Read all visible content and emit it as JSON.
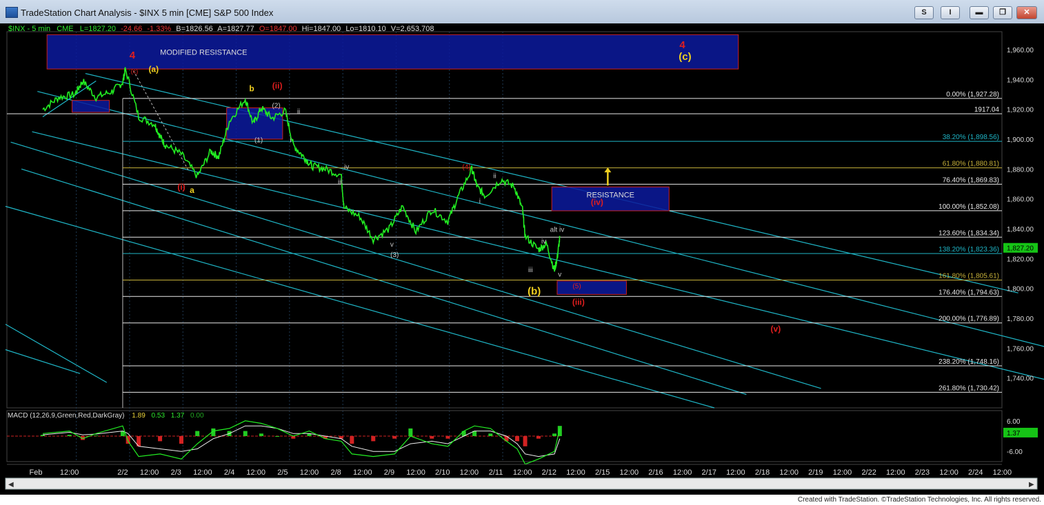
{
  "window": {
    "title": "TradeStation Chart Analysis - $INX 5 min [CME] S&P 500 Index",
    "btn_s": "S",
    "btn_i": "I",
    "min_glyph": "▬",
    "max_glyph": "❐",
    "close_glyph": "✕"
  },
  "colors": {
    "price": "#22ee22",
    "trendline": "#1fb7c8",
    "fib": "#e8e8e8",
    "fib_gold": "#c8b23a",
    "box_fill": "#0c1a9e",
    "box_border": "#c81e1e",
    "label_red": "#e01e1e",
    "label_yellow": "#f0d020",
    "macd": "#22ee22",
    "signal": "#e01e1e"
  },
  "footer": "Created with TradeStation. ©TradeStation Technologies, Inc. All rights reserved.",
  "chart_data": {
    "type": "line",
    "symbol_bar": {
      "name": "$INX - 5 min",
      "exchange": "CME",
      "last": "L=1827.20",
      "change": "-24.66",
      "change_pct": "-1.33%",
      "bid": "B=1826.56",
      "ask": "A=1827.77",
      "open": "O=1847.00",
      "high": "Hi=1847.00",
      "low": "Lo=1810.10",
      "volume": "V=2,653,708"
    },
    "ylim": [
      1720,
      1972
    ],
    "y_ticks": [
      "1,960.00",
      "1,940.00",
      "1,920.00",
      "1,900.00",
      "1,880.00",
      "1,860.00",
      "1,840.00",
      "1,820.00",
      "1,800.00",
      "1,780.00",
      "1,760.00",
      "1,740.00"
    ],
    "last_price_tag": "1,827.20",
    "x_ticks": [
      "Feb",
      "12:00",
      "2/2",
      "12:00",
      "2/3",
      "12:00",
      "2/4",
      "12:00",
      "2/5",
      "12:00",
      "2/8",
      "12:00",
      "2/9",
      "12:00",
      "2/10",
      "12:00",
      "2/11",
      "12:00",
      "2/12",
      "12:00",
      "2/15",
      "12:00",
      "2/16",
      "12:00",
      "2/17",
      "12:00",
      "2/18",
      "12:00",
      "2/19",
      "12:00",
      "2/22",
      "12:00",
      "2/23",
      "12:00",
      "2/24",
      "12:00"
    ],
    "x_tick_pos": [
      0.5,
      1,
      2,
      2.5,
      3,
      3.5,
      4,
      4.5,
      5,
      5.5,
      6,
      6.5,
      7,
      7.5,
      8,
      8.5,
      9,
      9.5,
      10,
      10.5,
      11,
      11.5,
      12,
      12.5,
      13,
      13.5,
      14,
      14.5,
      15,
      15.5,
      16,
      16.5,
      17,
      17.5,
      18,
      18.5
    ],
    "series": [
      {
        "x": [
          0,
          0.3,
          0.6,
          0.75,
          1,
          1.3,
          1.5,
          1.55,
          1.8,
          2.1,
          2.2,
          2.3,
          2.6,
          2.9,
          3.15,
          3.3,
          3.5,
          3.8,
          3.95,
          4.1,
          4.3,
          4.55,
          4.7,
          4.9,
          5.05,
          5.3,
          5.6,
          5.65,
          5.95,
          6.2,
          6.5,
          6.75,
          7.0,
          7.3,
          7.6,
          7.8,
          8.05,
          8.15,
          8.3,
          8.6,
          8.85,
          9.0,
          9.05,
          9.3,
          9.45,
          9.6,
          9.65,
          9.7
        ],
        "values": [
          1920,
          1928,
          1930,
          1939,
          1928,
          1932,
          1938,
          1947,
          1915,
          1910,
          1902,
          1896,
          1890,
          1875,
          1892,
          1888,
          1912,
          1927,
          1910,
          1921,
          1914,
          1919,
          1896,
          1888,
          1882,
          1880,
          1876,
          1854,
          1848,
          1833,
          1840,
          1855,
          1838,
          1853,
          1845,
          1862,
          1880,
          1868,
          1862,
          1873,
          1868,
          1853,
          1835,
          1826,
          1830,
          1812,
          1820,
          1834
        ]
      }
    ],
    "fib_levels": [
      {
        "label": "0.00% (1,927.28)",
        "value": 1927.28
      },
      {
        "label": "1917.04",
        "value": 1917.04
      },
      {
        "label": "38.20% (1,898.56)",
        "value": 1898.56
      },
      {
        "label": "61.80% (1,880.81)",
        "value": 1880.81
      },
      {
        "label": "76.40% (1,869.83)",
        "value": 1869.83
      },
      {
        "label": "100.00% (1,852.08)",
        "value": 1852.08
      },
      {
        "label": "123.60% (1,834.34)",
        "value": 1834.34
      },
      {
        "label": "138.20% (1,823.36)",
        "value": 1823.36
      },
      {
        "label": "161.80% (1,805.61)",
        "value": 1805.61
      },
      {
        "label": "176.40% (1,794.63)",
        "value": 1794.63
      },
      {
        "label": "200.00% (1,776.89)",
        "value": 1776.89
      },
      {
        "label": "238.20% (1,748.16)",
        "value": 1748.16
      },
      {
        "label": "261.80% (1,730.42)",
        "value": 1730.42
      }
    ],
    "boxes": [
      {
        "label": "MODIFIED RESISTANCE",
        "x0": 0.08,
        "x1": 13.05,
        "y0": 1947,
        "y1": 1970
      },
      {
        "label": "RESISTANCE",
        "x0": 9.55,
        "x1": 11.75,
        "y0": 1852,
        "y1": 1868
      },
      {
        "label": "",
        "x0": 0.55,
        "x1": 1.25,
        "y0": 1918,
        "y1": 1926
      },
      {
        "label": "",
        "x0": 3.45,
        "x1": 4.5,
        "y0": 1900,
        "y1": 1921
      },
      {
        "label": "",
        "x0": 9.65,
        "x1": 10.95,
        "y0": 1796,
        "y1": 1805
      }
    ],
    "annotations": [
      {
        "text": "4",
        "x": 1.68,
        "y": 1954,
        "color": "red",
        "size": 15
      },
      {
        "text": "(c)",
        "x": 1.72,
        "y": 1944,
        "color": "red",
        "size": 9
      },
      {
        "text": "(a)",
        "x": 2.08,
        "y": 1945,
        "color": "yellow",
        "size": 12
      },
      {
        "text": "b",
        "x": 3.92,
        "y": 1932,
        "color": "yellow",
        "size": 12
      },
      {
        "text": "(ii)",
        "x": 4.4,
        "y": 1934,
        "color": "red",
        "size": 12
      },
      {
        "text": "(2)",
        "x": 4.38,
        "y": 1921,
        "color": "gray",
        "size": 10
      },
      {
        "text": "ii",
        "x": 4.8,
        "y": 1917,
        "color": "gray",
        "size": 10
      },
      {
        "text": "(1)",
        "x": 4.05,
        "y": 1898,
        "color": "gray",
        "size": 10
      },
      {
        "text": "i",
        "x": 4.65,
        "y": 1898,
        "color": "gray",
        "size": 10
      },
      {
        "text": "iv",
        "x": 5.7,
        "y": 1880,
        "color": "gray",
        "size": 10
      },
      {
        "text": "iii",
        "x": 5.58,
        "y": 1870,
        "color": "gray",
        "size": 10
      },
      {
        "text": "(i)",
        "x": 2.6,
        "y": 1866,
        "color": "red",
        "size": 12
      },
      {
        "text": "a",
        "x": 2.8,
        "y": 1864,
        "color": "yellow",
        "size": 12
      },
      {
        "text": "(4)",
        "x": 7.95,
        "y": 1880,
        "color": "red",
        "size": 10
      },
      {
        "text": "ii",
        "x": 8.48,
        "y": 1874,
        "color": "gray",
        "size": 10
      },
      {
        "text": "i",
        "x": 8.2,
        "y": 1857,
        "color": "gray",
        "size": 10
      },
      {
        "text": "v",
        "x": 6.55,
        "y": 1828,
        "color": "gray",
        "size": 10
      },
      {
        "text": "(3)",
        "x": 6.6,
        "y": 1821,
        "color": "gray",
        "size": 10
      },
      {
        "text": "alt iv",
        "x": 9.65,
        "y": 1838,
        "color": "gray",
        "size": 10
      },
      {
        "text": "iv",
        "x": 9.4,
        "y": 1830,
        "color": "gray",
        "size": 10
      },
      {
        "text": "iii",
        "x": 9.15,
        "y": 1811,
        "color": "gray",
        "size": 10
      },
      {
        "text": "v",
        "x": 9.7,
        "y": 1808,
        "color": "gray",
        "size": 10
      },
      {
        "text": "(b)",
        "x": 9.22,
        "y": 1796,
        "color": "yellow",
        "size": 15
      },
      {
        "text": "(5)",
        "x": 10.02,
        "y": 1800,
        "color": "red",
        "size": 10
      },
      {
        "text": "(iii)",
        "x": 10.05,
        "y": 1789,
        "color": "red",
        "size": 12
      },
      {
        "text": "(iv)",
        "x": 10.4,
        "y": 1856,
        "color": "red",
        "size": 12
      },
      {
        "text": "4",
        "x": 12.0,
        "y": 1961,
        "color": "red",
        "size": 15
      },
      {
        "text": "(c)",
        "x": 12.05,
        "y": 1953,
        "color": "yellow",
        "size": 15
      },
      {
        "text": "(v)",
        "x": 13.75,
        "y": 1771,
        "color": "red",
        "size": 12
      }
    ],
    "arrow": {
      "x": 10.6,
      "y0": 1869,
      "y1": 1881,
      "color": "yellow"
    },
    "macd": {
      "label": "MACD (12,26,9,Green,Red,DarkGray)",
      "values": [
        "1.89",
        "0.53",
        "1.37",
        "0.00"
      ],
      "y_ticks": [
        "6.00",
        "-6.00"
      ],
      "last_tag": "1.37",
      "ylim": [
        -10,
        10
      ],
      "x": [
        0,
        0.5,
        0.75,
        1.0,
        1.5,
        1.6,
        1.8,
        2.2,
        2.6,
        2.9,
        3.2,
        3.5,
        3.8,
        4.1,
        4.4,
        4.7,
        5.0,
        5.3,
        5.6,
        5.8,
        6.2,
        6.6,
        6.9,
        7.3,
        7.6,
        7.9,
        8.1,
        8.4,
        8.7,
        8.9,
        9.05,
        9.3,
        9.6,
        9.7
      ],
      "macd_values": [
        1,
        2,
        -1,
        1,
        4,
        -2,
        -8,
        -7,
        -9,
        -3,
        2,
        3,
        6,
        5,
        3,
        0,
        2,
        -1,
        -2,
        -7,
        -8,
        -7,
        0,
        -3,
        -4,
        2,
        4,
        3,
        -2,
        -5,
        -11,
        -9,
        -6,
        3
      ],
      "signal_values": [
        0.5,
        1.5,
        0.5,
        0.8,
        2,
        1,
        -4,
        -5,
        -6,
        -5,
        -1,
        1,
        4,
        4,
        3,
        1,
        1,
        0,
        -1,
        -4,
        -6,
        -6,
        -3,
        -2,
        -3,
        0,
        2,
        2,
        0,
        -3,
        -7,
        -8,
        -7,
        -1
      ]
    }
  }
}
